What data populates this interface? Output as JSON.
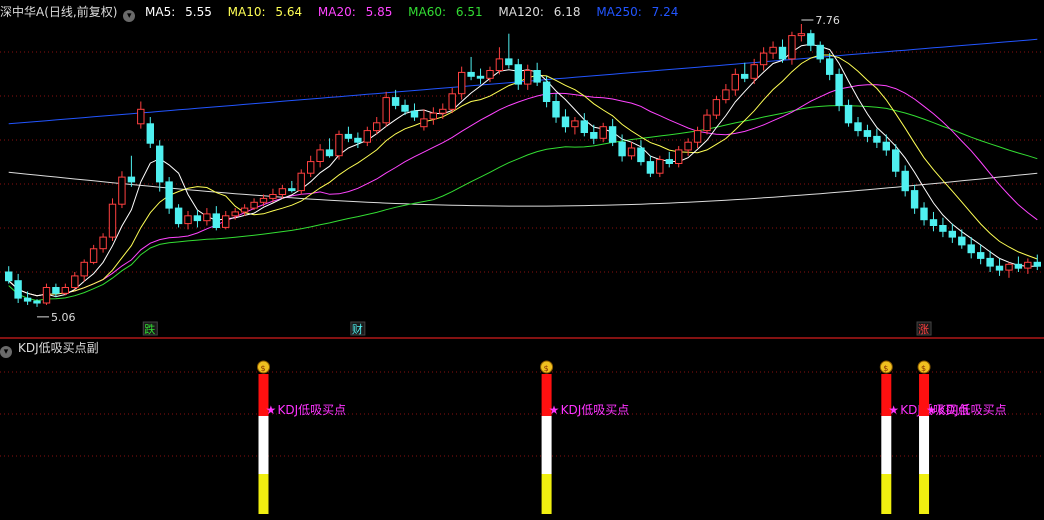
{
  "header": {
    "title": "深中华A(日线,前复权)",
    "collapse_icon": "chevron-down-icon",
    "ma": [
      {
        "label": "MA5:",
        "value": "5.55",
        "color": "#ffffff"
      },
      {
        "label": "MA10:",
        "value": "5.64",
        "color": "#ffff55"
      },
      {
        "label": "MA20:",
        "value": "5.85",
        "color": "#ff44ff"
      },
      {
        "label": "MA60:",
        "value": "6.51",
        "color": "#33dd33"
      },
      {
        "label": "MA120:",
        "value": "6.18",
        "color": "#dcdcdc"
      },
      {
        "label": "MA250:",
        "value": "7.24",
        "color": "#2255ff"
      }
    ]
  },
  "indicator": {
    "title": "KDJ低吸买点副",
    "collapse_icon": "chevron-down-icon"
  },
  "colors": {
    "up": "#ff4040",
    "down": "#4ff0f0",
    "grid": "#8a1010",
    "separator": "#b01818",
    "signal_red": "#ff1010",
    "signal_white": "#ffffff",
    "signal_yellow": "#f0ef10",
    "signal_text": "#ff33ff"
  },
  "chart_data": {
    "type": "candlestick",
    "price_range": [
      4.78,
      7.98
    ],
    "candles": [
      [
        5.42,
        5.48,
        5.3,
        5.33
      ],
      [
        5.33,
        5.4,
        5.1,
        5.15
      ],
      [
        5.15,
        5.22,
        5.08,
        5.12
      ],
      [
        5.12,
        5.14,
        5.06,
        5.1
      ],
      [
        5.1,
        5.3,
        5.08,
        5.26
      ],
      [
        5.26,
        5.3,
        5.16,
        5.2
      ],
      [
        5.2,
        5.3,
        5.18,
        5.26
      ],
      [
        5.26,
        5.42,
        5.24,
        5.38
      ],
      [
        5.38,
        5.55,
        5.32,
        5.52
      ],
      [
        5.52,
        5.7,
        5.5,
        5.66
      ],
      [
        5.66,
        5.82,
        5.62,
        5.78
      ],
      [
        5.78,
        6.18,
        5.74,
        6.12
      ],
      [
        6.12,
        6.46,
        6.08,
        6.4
      ],
      [
        6.4,
        6.62,
        6.3,
        6.35
      ],
      [
        6.95,
        7.18,
        6.9,
        7.1
      ],
      [
        6.95,
        7.02,
        6.7,
        6.75
      ],
      [
        6.72,
        6.78,
        6.25,
        6.35
      ],
      [
        6.35,
        6.4,
        6.02,
        6.08
      ],
      [
        6.08,
        6.12,
        5.88,
        5.92
      ],
      [
        5.92,
        6.05,
        5.86,
        6.0
      ],
      [
        6.0,
        6.06,
        5.88,
        5.95
      ],
      [
        5.95,
        6.08,
        5.9,
        6.02
      ],
      [
        6.02,
        6.1,
        5.85,
        5.88
      ],
      [
        5.88,
        6.05,
        5.86,
        6.0
      ],
      [
        6.0,
        6.08,
        5.96,
        6.04
      ],
      [
        6.04,
        6.12,
        6.0,
        6.08
      ],
      [
        6.08,
        6.18,
        6.06,
        6.14
      ],
      [
        6.14,
        6.22,
        6.1,
        6.18
      ],
      [
        6.18,
        6.28,
        6.14,
        6.22
      ],
      [
        6.22,
        6.32,
        6.18,
        6.28
      ],
      [
        6.28,
        6.36,
        6.24,
        6.26
      ],
      [
        6.26,
        6.48,
        6.22,
        6.44
      ],
      [
        6.44,
        6.62,
        6.4,
        6.56
      ],
      [
        6.56,
        6.74,
        6.5,
        6.68
      ],
      [
        6.68,
        6.8,
        6.6,
        6.62
      ],
      [
        6.62,
        6.88,
        6.58,
        6.84
      ],
      [
        6.84,
        6.92,
        6.76,
        6.8
      ],
      [
        6.8,
        6.86,
        6.7,
        6.76
      ],
      [
        6.76,
        6.92,
        6.72,
        6.88
      ],
      [
        6.88,
        7.02,
        6.84,
        6.96
      ],
      [
        6.96,
        7.28,
        6.92,
        7.22
      ],
      [
        7.22,
        7.3,
        7.1,
        7.14
      ],
      [
        7.14,
        7.2,
        7.04,
        7.08
      ],
      [
        7.08,
        7.16,
        6.98,
        7.02
      ],
      [
        6.92,
        7.1,
        6.88,
        7.0
      ],
      [
        7.0,
        7.12,
        6.94,
        7.06
      ],
      [
        7.06,
        7.16,
        7.0,
        7.1
      ],
      [
        7.1,
        7.32,
        7.06,
        7.26
      ],
      [
        7.26,
        7.54,
        7.2,
        7.48
      ],
      [
        7.48,
        7.64,
        7.4,
        7.44
      ],
      [
        7.44,
        7.52,
        7.36,
        7.42
      ],
      [
        7.42,
        7.54,
        7.38,
        7.5
      ],
      [
        7.5,
        7.74,
        7.46,
        7.62
      ],
      [
        7.62,
        7.88,
        7.52,
        7.56
      ],
      [
        7.56,
        7.62,
        7.3,
        7.36
      ],
      [
        7.36,
        7.56,
        7.3,
        7.5
      ],
      [
        7.5,
        7.58,
        7.34,
        7.38
      ],
      [
        7.38,
        7.44,
        7.12,
        7.18
      ],
      [
        7.18,
        7.26,
        6.96,
        7.02
      ],
      [
        7.02,
        7.1,
        6.86,
        6.92
      ],
      [
        6.92,
        7.02,
        6.84,
        6.98
      ],
      [
        6.98,
        7.06,
        6.82,
        6.86
      ],
      [
        6.86,
        6.94,
        6.74,
        6.8
      ],
      [
        6.8,
        6.96,
        6.76,
        6.92
      ],
      [
        6.92,
        7.0,
        6.72,
        6.76
      ],
      [
        6.76,
        6.84,
        6.56,
        6.62
      ],
      [
        6.62,
        6.76,
        6.58,
        6.7
      ],
      [
        6.7,
        6.78,
        6.52,
        6.56
      ],
      [
        6.56,
        6.62,
        6.4,
        6.44
      ],
      [
        6.44,
        6.62,
        6.4,
        6.58
      ],
      [
        6.58,
        6.66,
        6.5,
        6.54
      ],
      [
        6.54,
        6.72,
        6.5,
        6.68
      ],
      [
        6.68,
        6.8,
        6.62,
        6.76
      ],
      [
        6.76,
        6.92,
        6.7,
        6.88
      ],
      [
        6.88,
        7.1,
        6.84,
        7.04
      ],
      [
        7.04,
        7.24,
        7.0,
        7.2
      ],
      [
        7.2,
        7.36,
        7.16,
        7.3
      ],
      [
        7.3,
        7.52,
        7.24,
        7.46
      ],
      [
        7.46,
        7.58,
        7.38,
        7.42
      ],
      [
        7.42,
        7.62,
        7.36,
        7.56
      ],
      [
        7.56,
        7.74,
        7.5,
        7.68
      ],
      [
        7.68,
        7.8,
        7.62,
        7.74
      ],
      [
        7.74,
        7.82,
        7.58,
        7.62
      ],
      [
        7.62,
        7.9,
        7.56,
        7.86
      ],
      [
        7.86,
        7.98,
        7.8,
        7.88
      ],
      [
        7.88,
        7.92,
        7.7,
        7.76
      ],
      [
        7.76,
        7.8,
        7.58,
        7.62
      ],
      [
        7.62,
        7.68,
        7.4,
        7.46
      ],
      [
        7.46,
        7.52,
        7.08,
        7.14
      ],
      [
        7.14,
        7.2,
        6.92,
        6.96
      ],
      [
        6.96,
        7.02,
        6.82,
        6.88
      ],
      [
        6.88,
        6.94,
        6.76,
        6.82
      ],
      [
        6.82,
        6.9,
        6.7,
        6.76
      ],
      [
        6.76,
        6.84,
        6.62,
        6.68
      ],
      [
        6.68,
        6.74,
        6.4,
        6.46
      ],
      [
        6.46,
        6.52,
        6.2,
        6.26
      ],
      [
        6.26,
        6.32,
        6.02,
        6.08
      ],
      [
        6.08,
        6.14,
        5.9,
        5.96
      ],
      [
        5.96,
        6.04,
        5.84,
        5.9
      ],
      [
        5.9,
        5.98,
        5.78,
        5.84
      ],
      [
        5.84,
        5.92,
        5.72,
        5.78
      ],
      [
        5.78,
        5.86,
        5.66,
        5.7
      ],
      [
        5.7,
        5.78,
        5.56,
        5.62
      ],
      [
        5.62,
        5.7,
        5.5,
        5.56
      ],
      [
        5.56,
        5.64,
        5.42,
        5.48
      ],
      [
        5.48,
        5.56,
        5.38,
        5.44
      ],
      [
        5.44,
        5.52,
        5.36,
        5.5
      ],
      [
        5.5,
        5.58,
        5.42,
        5.46
      ],
      [
        5.46,
        5.56,
        5.4,
        5.52
      ],
      [
        5.52,
        5.6,
        5.44,
        5.48
      ]
    ],
    "annotations": [
      {
        "text": "5.06",
        "kind": "low"
      },
      {
        "text": "7.76",
        "kind": "high"
      }
    ],
    "event_markers": [
      {
        "text": "跌",
        "color": "#33dd33"
      },
      {
        "text": "财",
        "color": "#4ff0f0"
      },
      {
        "text": "涨",
        "color": "#ff4040"
      }
    ],
    "buy_signals": [
      {
        "label": "KDJ低吸买点",
        "icon": "money-bag-icon"
      },
      {
        "label": "KDJ低吸买点",
        "icon": "money-bag-icon"
      },
      {
        "label": "KDJ低吸买点",
        "icon": "money-bag-icon"
      },
      {
        "label": "KDJ低吸买点",
        "icon": "money-bag-icon"
      }
    ]
  }
}
